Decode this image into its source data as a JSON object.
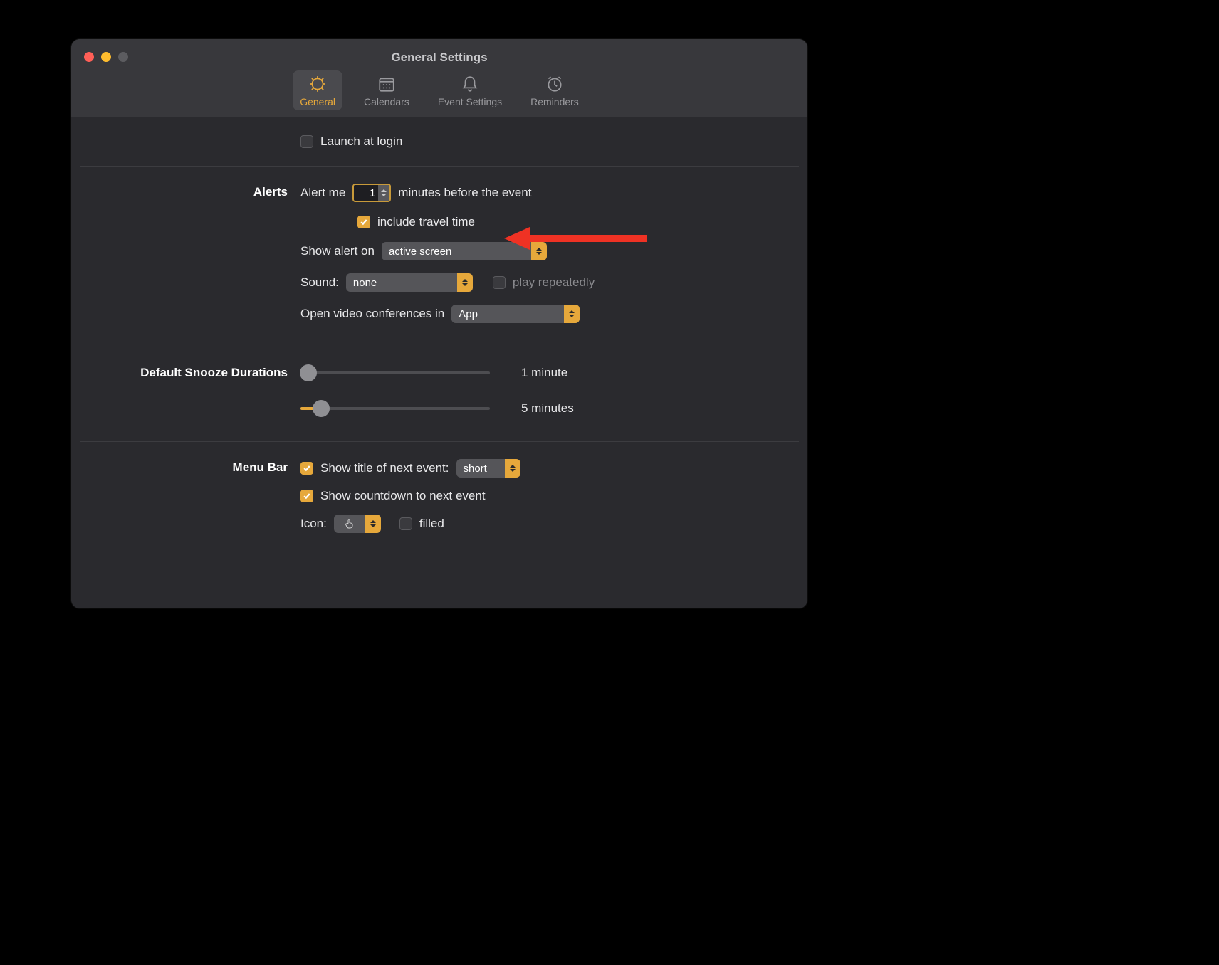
{
  "window": {
    "title": "General Settings"
  },
  "toolbar": {
    "general": "General",
    "calendars": "Calendars",
    "event_settings": "Event Settings",
    "reminders": "Reminders"
  },
  "launch": {
    "label": "Launch at login",
    "checked": false
  },
  "alerts": {
    "section": "Alerts",
    "alert_me_pre": "Alert me",
    "alert_me_value": "1",
    "alert_me_post": "minutes before the event",
    "include_travel_label": "include travel time",
    "include_travel_checked": true,
    "show_alert_label": "Show alert on",
    "show_alert_value": "active screen",
    "sound_label": "Sound:",
    "sound_value": "none",
    "play_repeatedly_label": "play repeatedly",
    "play_repeatedly_checked": false,
    "open_video_label": "Open video conferences in",
    "open_video_value": "App"
  },
  "snooze": {
    "section": "Default Snooze Durations",
    "slider1_label": "1 minute",
    "slider2_label": "5 minutes"
  },
  "menubar": {
    "section": "Menu Bar",
    "show_title_label": "Show title of next event:",
    "show_title_checked": true,
    "show_title_value": "short",
    "show_countdown_label": "Show countdown to next event",
    "show_countdown_checked": true,
    "icon_label": "Icon:",
    "filled_label": "filled",
    "filled_checked": false
  }
}
